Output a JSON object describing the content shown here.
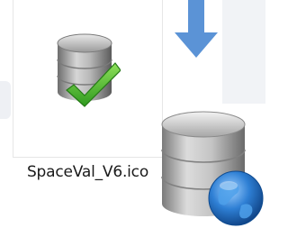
{
  "file": {
    "name": "SpaceVal_V6.ico",
    "icon": "database-checkmark-icon"
  },
  "decorations": {
    "arrow_icon": "down-arrow-icon",
    "large_icon": "database-globe-icon"
  },
  "colors": {
    "arrow": "#5b93d6",
    "check": "#4fbf2e",
    "globe": "#2e7fd4",
    "db_gray": "#8c8c8c"
  }
}
